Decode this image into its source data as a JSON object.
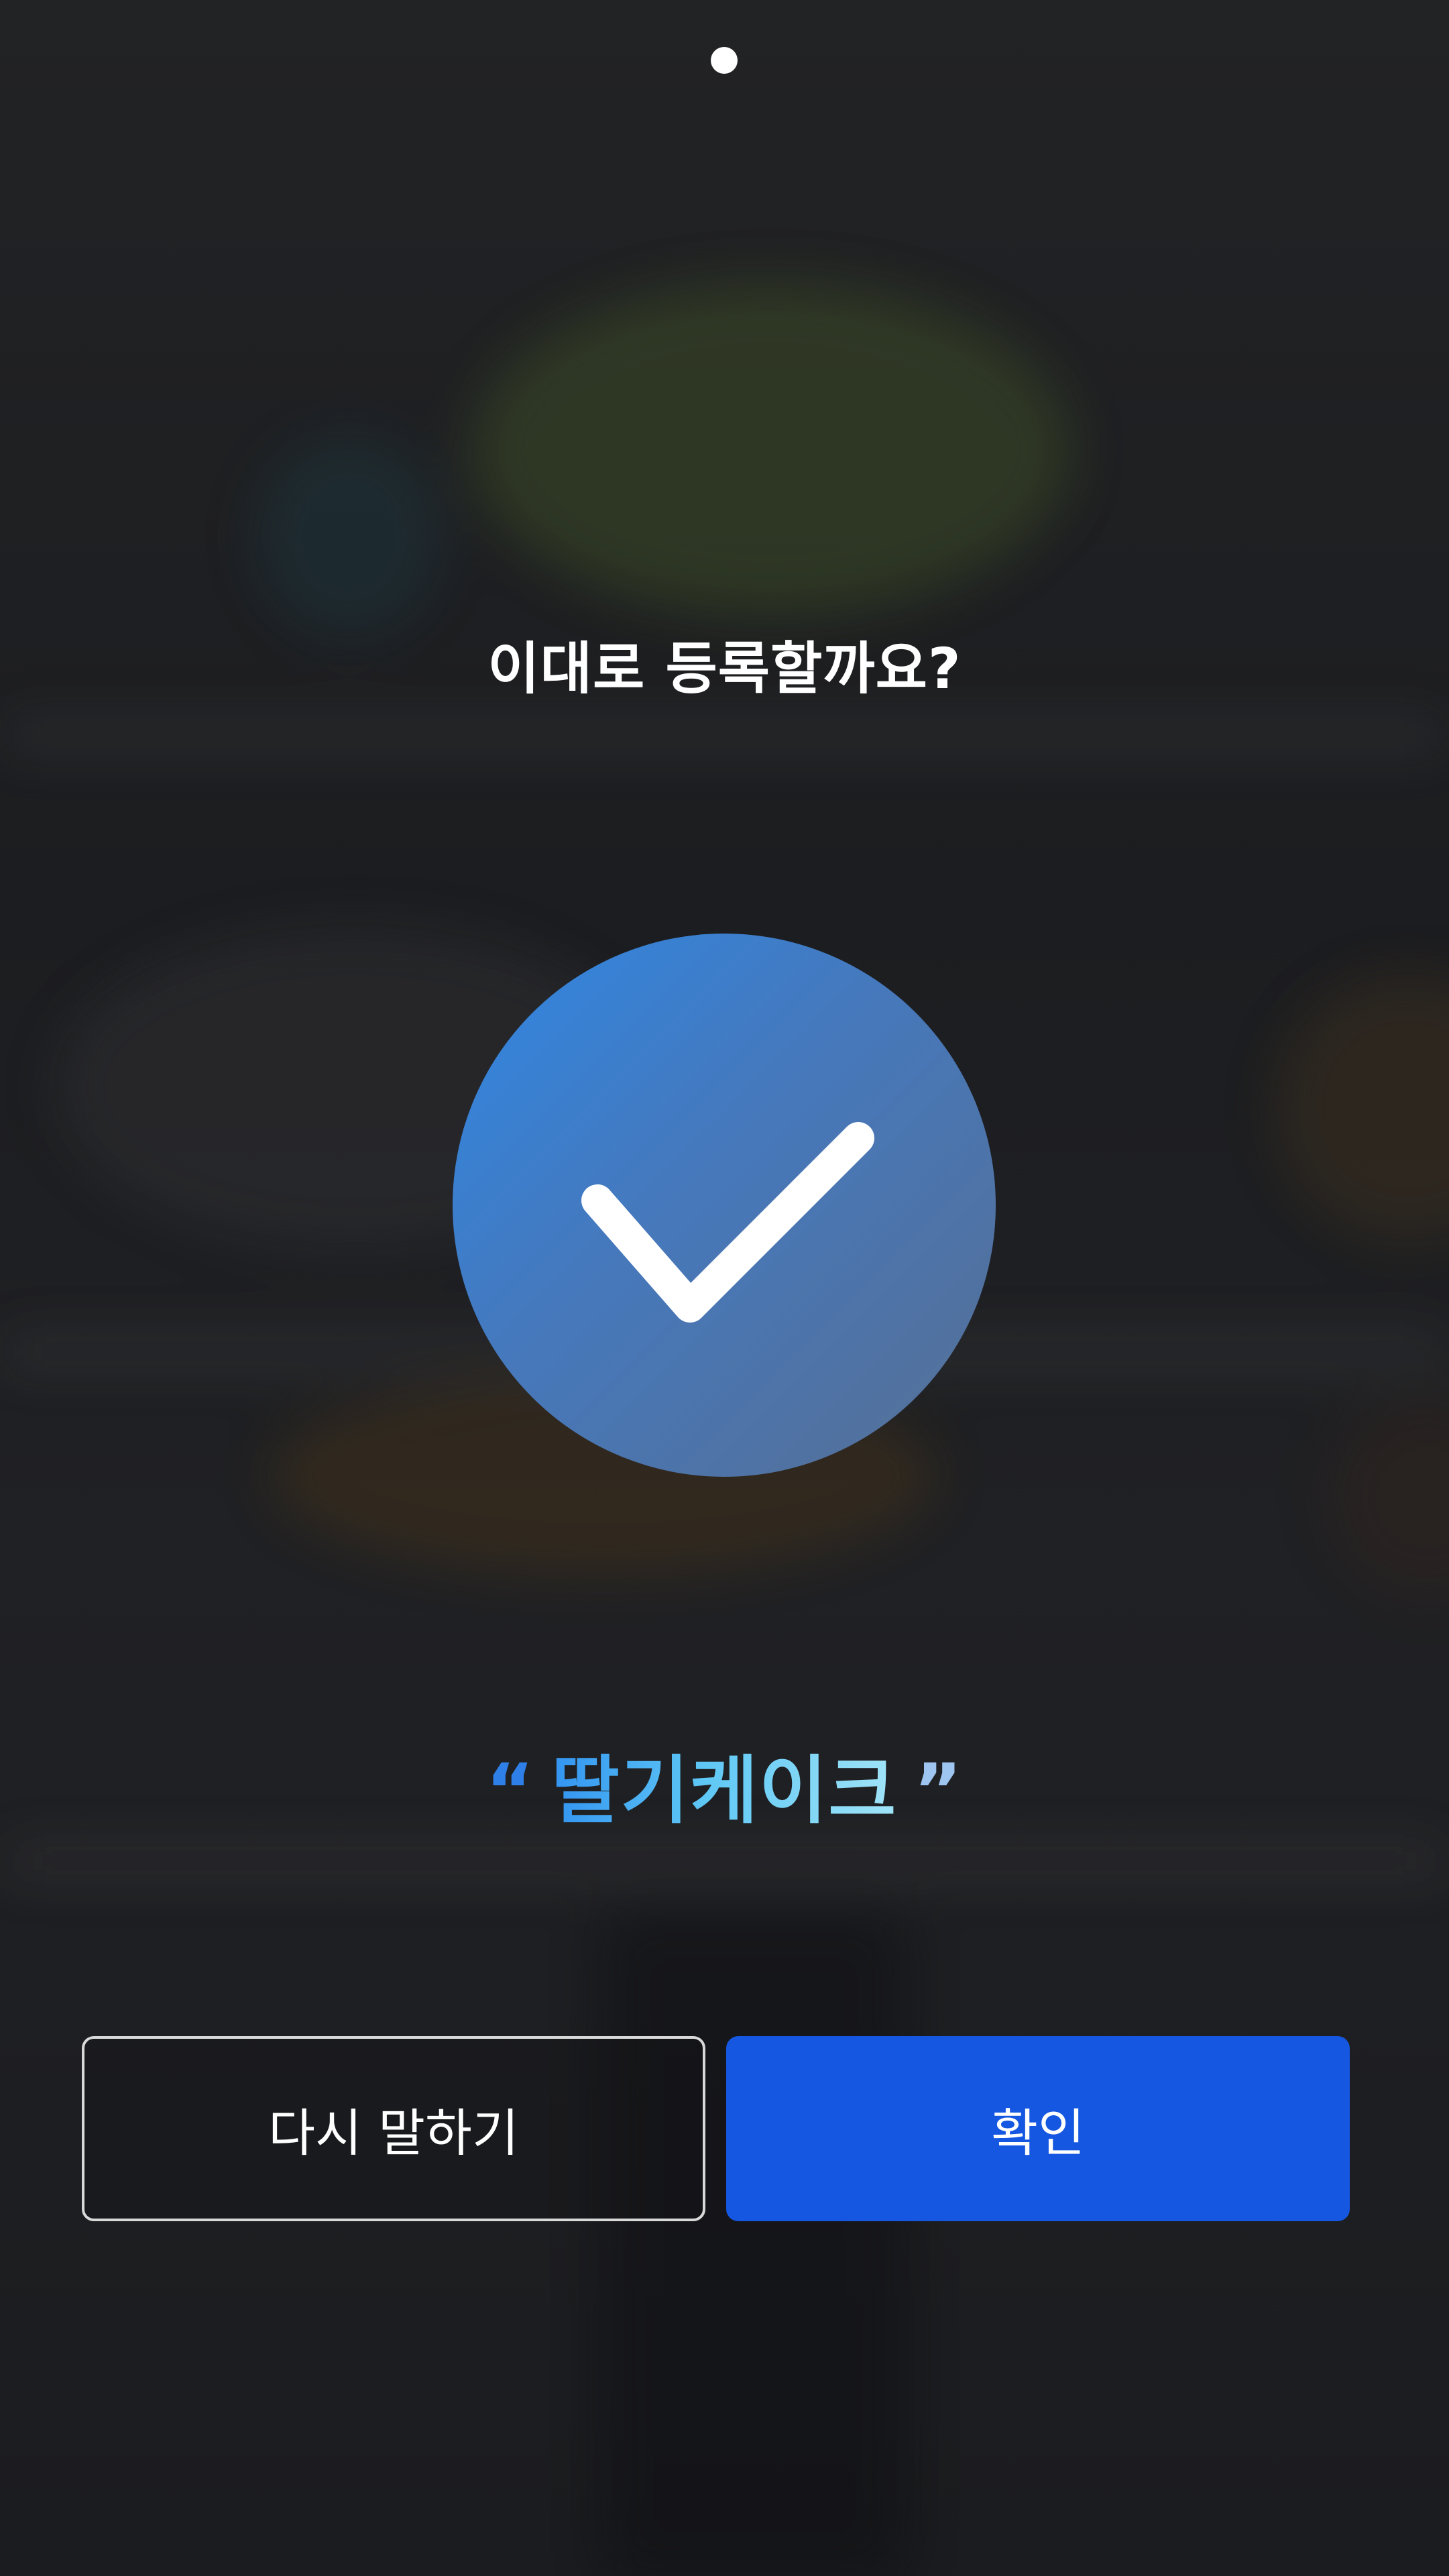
{
  "prompt": {
    "question": "이대로 등록할까요?"
  },
  "result": {
    "open_quote": "“",
    "text": "딸기케이크",
    "close_quote": "”"
  },
  "buttons": {
    "retry_label": "다시 말하기",
    "confirm_label": "확인"
  },
  "colors": {
    "confirm_button": "#1557e0",
    "check_circle_start": "#2f87e4",
    "check_circle_end": "#566f94",
    "background": "#1f2023"
  },
  "icons": {
    "status": "check-icon",
    "indicator": "page-indicator-dot"
  }
}
